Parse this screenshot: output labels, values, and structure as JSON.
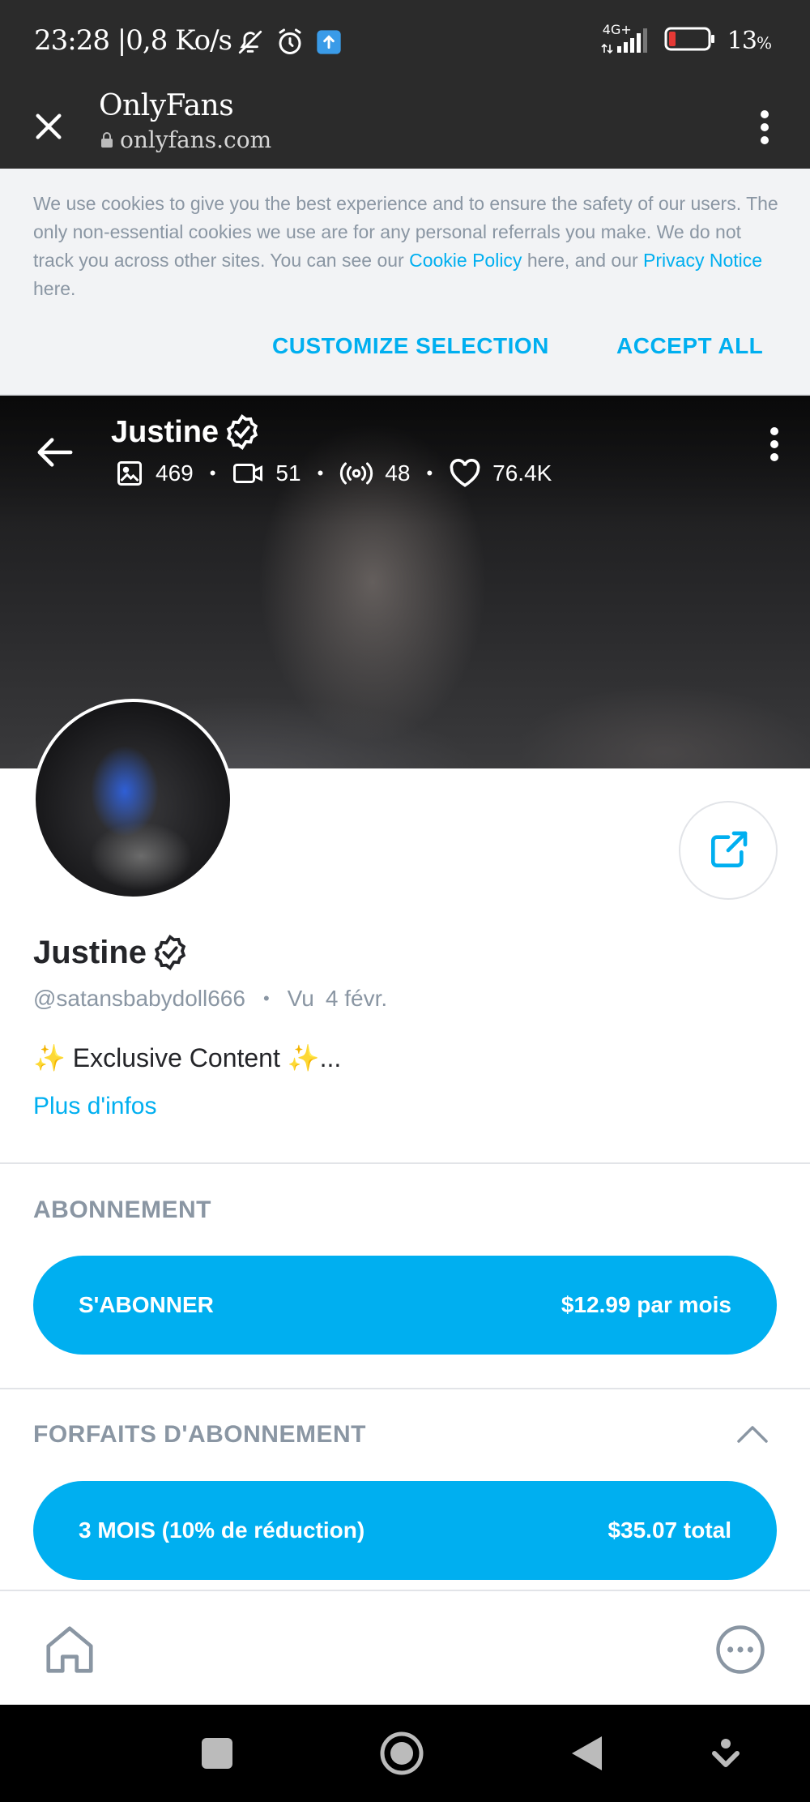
{
  "status_bar": {
    "time": "23:28",
    "speed": "0,8 Ko/s",
    "network": "4G+",
    "battery": "13",
    "battery_unit": "%",
    "icons": [
      "bell-off-icon",
      "alarm-icon",
      "upload-notification-icon",
      "signal-icon",
      "battery-icon"
    ]
  },
  "browser": {
    "title": "OnlyFans",
    "url": "onlyfans.com"
  },
  "cookie_banner": {
    "text_1": "We use cookies to give you the best experience and to ensure the safety of our users. The only non-essential cookies we use are for any personal referrals you make. We do not track you across other sites. You can see our ",
    "link_1": "Cookie Policy",
    "text_2": " here, and our ",
    "link_2": "Privacy Notice",
    "text_3": " here.",
    "customize_label": "CUSTOMIZE SELECTION",
    "accept_label": "ACCEPT ALL"
  },
  "cover": {
    "name": "Justine",
    "stats": {
      "photos": "469",
      "videos": "51",
      "streams": "48",
      "likes": "76.4K"
    },
    "separator": "•"
  },
  "profile": {
    "name": "Justine",
    "handle": "@satansbabydoll666",
    "separator": "•",
    "seen_label": "Vu",
    "seen_date": "4 févr.",
    "bio": "✨ Exclusive Content ✨...",
    "more_label": "Plus d'infos"
  },
  "subscription": {
    "section_title": "ABONNEMENT",
    "button_label": "S'ABONNER",
    "button_price": "$12.99 par mois"
  },
  "bundles": {
    "section_title": "FORFAITS D'ABONNEMENT",
    "items": [
      {
        "label": "3 MOIS (10% de réduction)",
        "price": "$35.07 total"
      }
    ]
  },
  "colors": {
    "accent": "#00aff0",
    "muted": "#8a96a3",
    "text": "#242529",
    "chrome": "#2b2b2b"
  }
}
